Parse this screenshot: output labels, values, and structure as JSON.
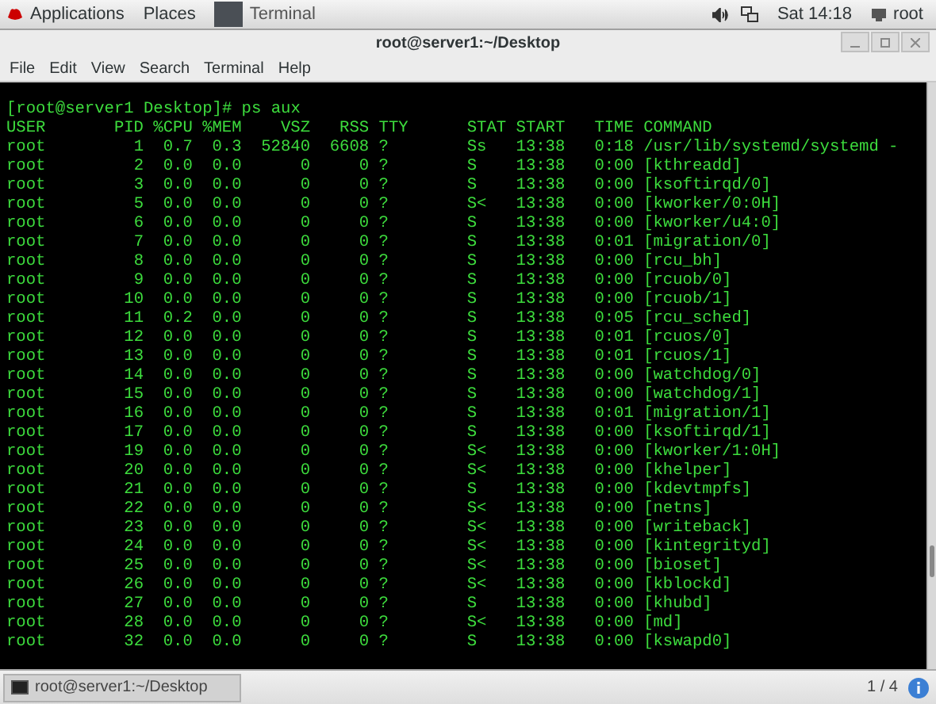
{
  "top_bar": {
    "menus": [
      "Applications",
      "Places"
    ],
    "task": "Terminal",
    "clock": "Sat 14:18",
    "user": "root"
  },
  "window": {
    "title": "root@server1:~/Desktop",
    "menu": [
      "File",
      "Edit",
      "View",
      "Search",
      "Terminal",
      "Help"
    ]
  },
  "terminal": {
    "prompt": "[root@server1 Desktop]# ps aux",
    "columns": [
      "USER",
      "PID",
      "%CPU",
      "%MEM",
      "VSZ",
      "RSS",
      "TTY",
      "STAT",
      "START",
      "TIME",
      "COMMAND"
    ],
    "rows": [
      [
        "root",
        "1",
        "0.7",
        "0.3",
        "52840",
        "6608",
        "?",
        "Ss",
        "13:38",
        "0:18",
        "/usr/lib/systemd/systemd -"
      ],
      [
        "root",
        "2",
        "0.0",
        "0.0",
        "0",
        "0",
        "?",
        "S",
        "13:38",
        "0:00",
        "[kthreadd]"
      ],
      [
        "root",
        "3",
        "0.0",
        "0.0",
        "0",
        "0",
        "?",
        "S",
        "13:38",
        "0:00",
        "[ksoftirqd/0]"
      ],
      [
        "root",
        "5",
        "0.0",
        "0.0",
        "0",
        "0",
        "?",
        "S<",
        "13:38",
        "0:00",
        "[kworker/0:0H]"
      ],
      [
        "root",
        "6",
        "0.0",
        "0.0",
        "0",
        "0",
        "?",
        "S",
        "13:38",
        "0:00",
        "[kworker/u4:0]"
      ],
      [
        "root",
        "7",
        "0.0",
        "0.0",
        "0",
        "0",
        "?",
        "S",
        "13:38",
        "0:01",
        "[migration/0]"
      ],
      [
        "root",
        "8",
        "0.0",
        "0.0",
        "0",
        "0",
        "?",
        "S",
        "13:38",
        "0:00",
        "[rcu_bh]"
      ],
      [
        "root",
        "9",
        "0.0",
        "0.0",
        "0",
        "0",
        "?",
        "S",
        "13:38",
        "0:00",
        "[rcuob/0]"
      ],
      [
        "root",
        "10",
        "0.0",
        "0.0",
        "0",
        "0",
        "?",
        "S",
        "13:38",
        "0:00",
        "[rcuob/1]"
      ],
      [
        "root",
        "11",
        "0.2",
        "0.0",
        "0",
        "0",
        "?",
        "S",
        "13:38",
        "0:05",
        "[rcu_sched]"
      ],
      [
        "root",
        "12",
        "0.0",
        "0.0",
        "0",
        "0",
        "?",
        "S",
        "13:38",
        "0:01",
        "[rcuos/0]"
      ],
      [
        "root",
        "13",
        "0.0",
        "0.0",
        "0",
        "0",
        "?",
        "S",
        "13:38",
        "0:01",
        "[rcuos/1]"
      ],
      [
        "root",
        "14",
        "0.0",
        "0.0",
        "0",
        "0",
        "?",
        "S",
        "13:38",
        "0:00",
        "[watchdog/0]"
      ],
      [
        "root",
        "15",
        "0.0",
        "0.0",
        "0",
        "0",
        "?",
        "S",
        "13:38",
        "0:00",
        "[watchdog/1]"
      ],
      [
        "root",
        "16",
        "0.0",
        "0.0",
        "0",
        "0",
        "?",
        "S",
        "13:38",
        "0:01",
        "[migration/1]"
      ],
      [
        "root",
        "17",
        "0.0",
        "0.0",
        "0",
        "0",
        "?",
        "S",
        "13:38",
        "0:00",
        "[ksoftirqd/1]"
      ],
      [
        "root",
        "19",
        "0.0",
        "0.0",
        "0",
        "0",
        "?",
        "S<",
        "13:38",
        "0:00",
        "[kworker/1:0H]"
      ],
      [
        "root",
        "20",
        "0.0",
        "0.0",
        "0",
        "0",
        "?",
        "S<",
        "13:38",
        "0:00",
        "[khelper]"
      ],
      [
        "root",
        "21",
        "0.0",
        "0.0",
        "0",
        "0",
        "?",
        "S",
        "13:38",
        "0:00",
        "[kdevtmpfs]"
      ],
      [
        "root",
        "22",
        "0.0",
        "0.0",
        "0",
        "0",
        "?",
        "S<",
        "13:38",
        "0:00",
        "[netns]"
      ],
      [
        "root",
        "23",
        "0.0",
        "0.0",
        "0",
        "0",
        "?",
        "S<",
        "13:38",
        "0:00",
        "[writeback]"
      ],
      [
        "root",
        "24",
        "0.0",
        "0.0",
        "0",
        "0",
        "?",
        "S<",
        "13:38",
        "0:00",
        "[kintegrityd]"
      ],
      [
        "root",
        "25",
        "0.0",
        "0.0",
        "0",
        "0",
        "?",
        "S<",
        "13:38",
        "0:00",
        "[bioset]"
      ],
      [
        "root",
        "26",
        "0.0",
        "0.0",
        "0",
        "0",
        "?",
        "S<",
        "13:38",
        "0:00",
        "[kblockd]"
      ],
      [
        "root",
        "27",
        "0.0",
        "0.0",
        "0",
        "0",
        "?",
        "S",
        "13:38",
        "0:00",
        "[khubd]"
      ],
      [
        "root",
        "28",
        "0.0",
        "0.0",
        "0",
        "0",
        "?",
        "S<",
        "13:38",
        "0:00",
        "[md]"
      ],
      [
        "root",
        "32",
        "0.0",
        "0.0",
        "0",
        "0",
        "?",
        "S",
        "13:38",
        "0:00",
        "[kswapd0]"
      ]
    ]
  },
  "taskbar": {
    "task": "root@server1:~/Desktop",
    "workspace": "1 / 4"
  }
}
